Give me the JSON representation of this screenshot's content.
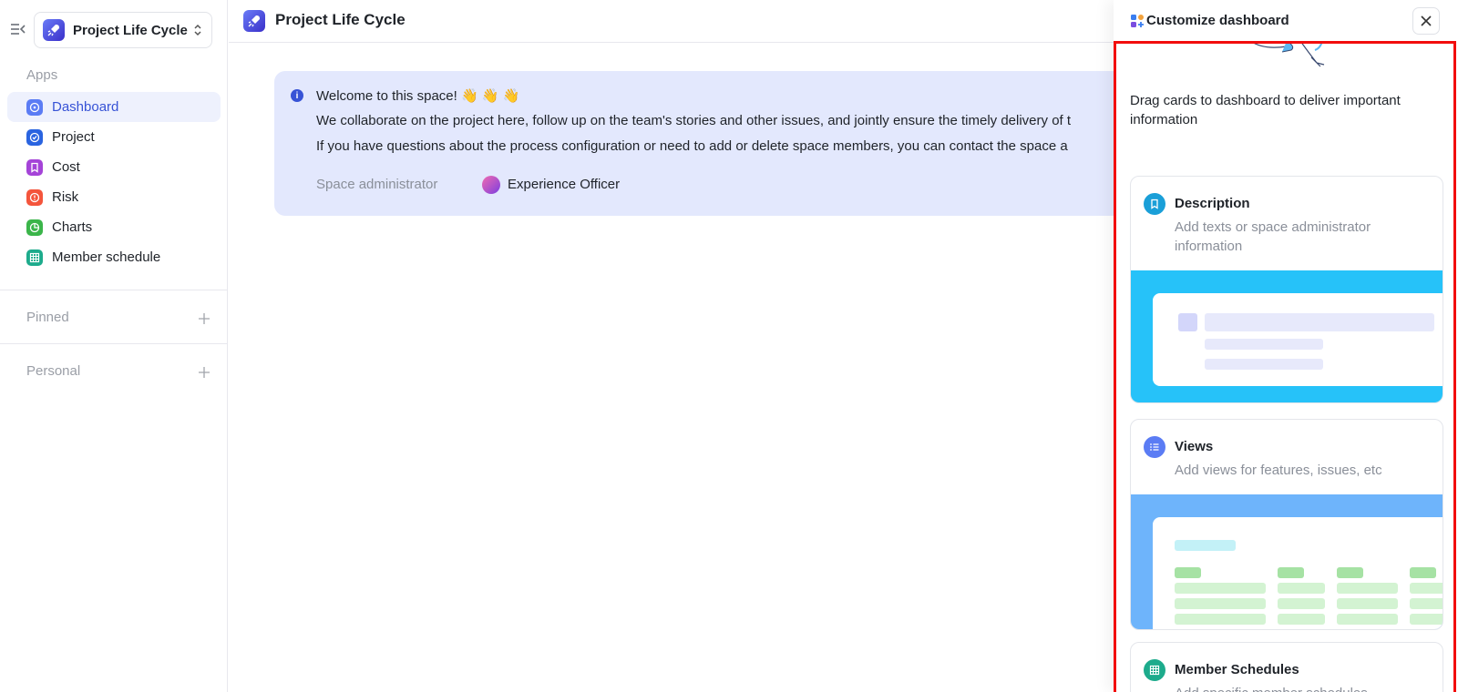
{
  "sidebar": {
    "space_name": "Project Life Cycle",
    "sections": {
      "apps": "Apps",
      "pinned": "Pinned",
      "personal": "Personal"
    },
    "items": [
      {
        "label": "Dashboard",
        "icon": "dashboard-icon",
        "color": "#5b7cf4"
      },
      {
        "label": "Project",
        "icon": "project-icon",
        "color": "#2a64e0"
      },
      {
        "label": "Cost",
        "icon": "cost-icon",
        "color": "#a544d8"
      },
      {
        "label": "Risk",
        "icon": "risk-icon",
        "color": "#f4553c"
      },
      {
        "label": "Charts",
        "icon": "charts-icon",
        "color": "#3bb54a"
      },
      {
        "label": "Member schedule",
        "icon": "member-schedule-icon",
        "color": "#1dab8c"
      }
    ]
  },
  "header": {
    "title": "Project Life Cycle"
  },
  "welcome": {
    "line1": "Welcome to this space! 👋 👋 👋",
    "line2": "We collaborate on the project here, follow up on the team's stories and other issues, and jointly ensure the timely delivery of t",
    "line3": "If you have questions about the process configuration or need to add or delete space members, you can contact the space a",
    "admin_label": "Space administrator",
    "admin_name": "Experience Officer"
  },
  "panel": {
    "title": "Customize dashboard",
    "intro": "Drag cards to dashboard to deliver important information",
    "cards": [
      {
        "title": "Description",
        "desc": "Add texts or space administrator information",
        "icon": "description-icon",
        "color": "#1a9fd8"
      },
      {
        "title": "Views",
        "desc": "Add views for features, issues, etc",
        "icon": "views-icon",
        "color": "#5b7cf4"
      },
      {
        "title": "Member Schedules",
        "desc": "Add specific member schedules",
        "icon": "member-schedules-icon",
        "color": "#1dab8c"
      }
    ]
  }
}
